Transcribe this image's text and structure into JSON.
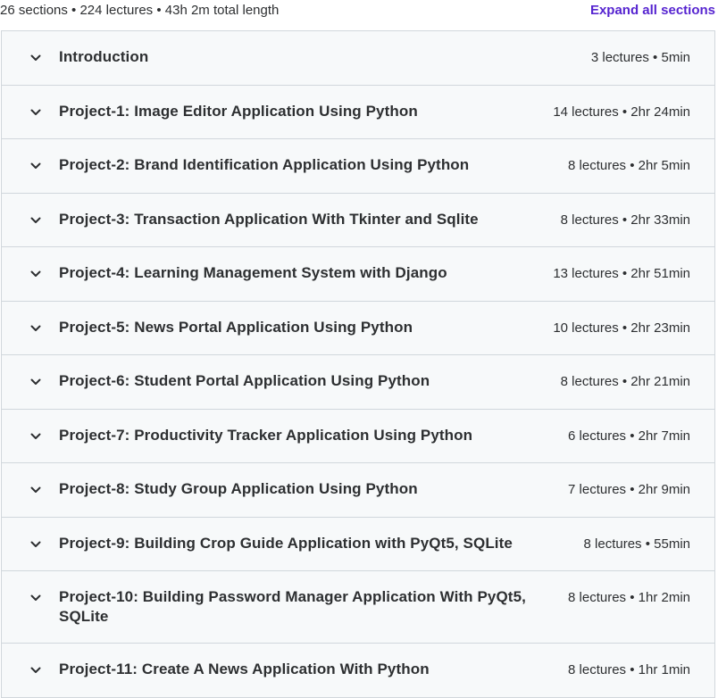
{
  "header": {
    "summary": "26 sections • 224 lectures • 43h 2m total length",
    "expand_all_label": "Expand all sections"
  },
  "colors": {
    "accent": "#5624d0",
    "section_background": "#f7f9fa",
    "border": "#d1d7dc",
    "text": "#2d2f31"
  },
  "sections": [
    {
      "title": "Introduction",
      "meta": "3 lectures • 5min",
      "icon": "chevron-down-icon"
    },
    {
      "title": "Project-1: Image Editor Application Using Python",
      "meta": "14 lectures • 2hr 24min",
      "icon": "chevron-down-icon"
    },
    {
      "title": "Project-2: Brand Identification Application Using Python",
      "meta": "8 lectures • 2hr 5min",
      "icon": "chevron-down-icon"
    },
    {
      "title": "Project-3: Transaction Application With Tkinter and Sqlite",
      "meta": "8 lectures • 2hr 33min",
      "icon": "chevron-down-icon"
    },
    {
      "title": "Project-4: Learning Management System with Django",
      "meta": "13 lectures • 2hr 51min",
      "icon": "chevron-down-icon"
    },
    {
      "title": "Project-5: News Portal Application Using Python",
      "meta": "10 lectures • 2hr 23min",
      "icon": "chevron-down-icon"
    },
    {
      "title": "Project-6: Student Portal Application Using Python",
      "meta": "8 lectures • 2hr 21min",
      "icon": "chevron-down-icon"
    },
    {
      "title": "Project-7: Productivity Tracker Application Using Python",
      "meta": "6 lectures • 2hr 7min",
      "icon": "chevron-down-icon"
    },
    {
      "title": "Project-8: Study Group Application Using Python",
      "meta": "7 lectures • 2hr 9min",
      "icon": "chevron-down-icon"
    },
    {
      "title": "Project-9: Building Crop Guide Application with PyQt5, SQLite",
      "meta": "8 lectures • 55min",
      "icon": "chevron-down-icon"
    },
    {
      "title": "Project-10: Building Password Manager Application With PyQt5, SQLite",
      "meta": "8 lectures • 1hr 2min",
      "icon": "chevron-down-icon"
    },
    {
      "title": "Project-11: Create A News Application With Python",
      "meta": "8 lectures • 1hr 1min",
      "icon": "chevron-down-icon"
    }
  ]
}
